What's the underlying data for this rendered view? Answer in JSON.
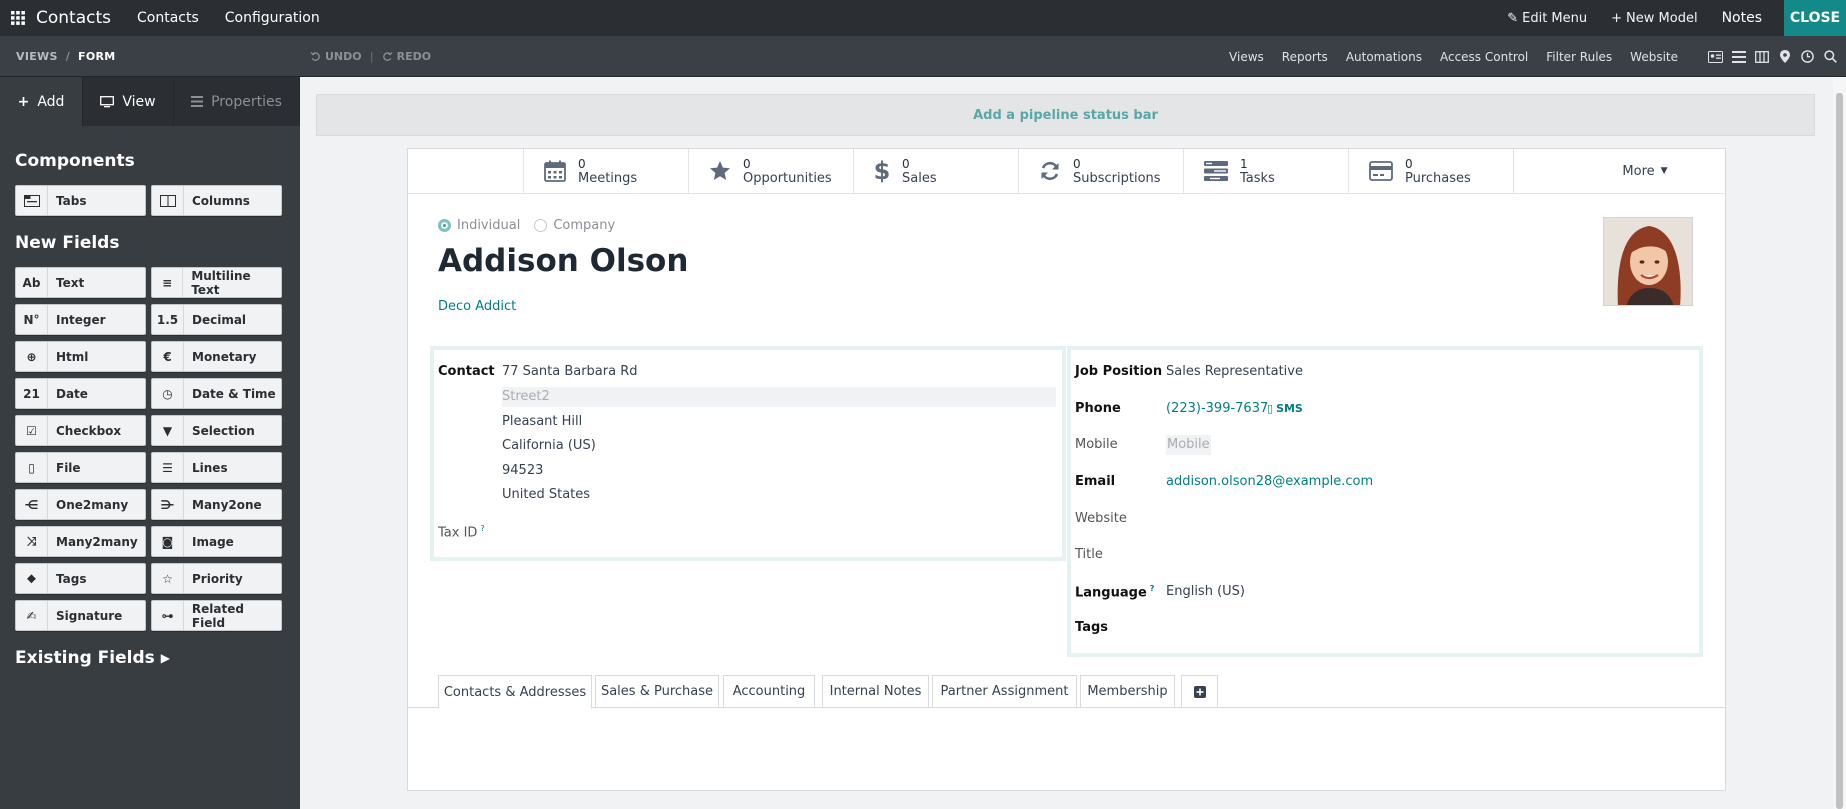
{
  "topbar": {
    "app_title": "Contacts",
    "menu": [
      "Contacts",
      "Configuration"
    ],
    "edit_menu": "Edit Menu",
    "new_model": "New Model",
    "notes": "Notes",
    "close": "CLOSE"
  },
  "secondary": {
    "breadcrumb": [
      "VIEWS",
      "FORM"
    ],
    "undo": "UNDO",
    "redo": "REDO",
    "links": [
      "Views",
      "Reports",
      "Automations",
      "Access Control",
      "Filter Rules",
      "Website"
    ],
    "view_icons": [
      "contact-card-icon",
      "list-icon",
      "kanban-icon",
      "map-pin-icon",
      "clock-icon",
      "search-icon"
    ]
  },
  "sidebar": {
    "tabs": [
      "Add",
      "View",
      "Properties"
    ],
    "components_title": "Components",
    "components": [
      {
        "label": "Tabs",
        "icon": "tabs-icon"
      },
      {
        "label": "Columns",
        "icon": "columns-icon"
      }
    ],
    "new_fields_title": "New Fields",
    "fields": [
      {
        "label": "Text",
        "icon": "text-icon",
        "glyph": "Ab"
      },
      {
        "label": "Multiline Text",
        "icon": "multiline-text-icon",
        "glyph": "≡"
      },
      {
        "label": "Integer",
        "icon": "integer-icon",
        "glyph": "N°"
      },
      {
        "label": "Decimal",
        "icon": "decimal-icon",
        "glyph": "1.5"
      },
      {
        "label": "Html",
        "icon": "html-globe-icon",
        "glyph": "⊕"
      },
      {
        "label": "Monetary",
        "icon": "monetary-icon",
        "glyph": "€"
      },
      {
        "label": "Date",
        "icon": "date-icon",
        "glyph": "21"
      },
      {
        "label": "Date & Time",
        "icon": "date-time-icon",
        "glyph": "◷"
      },
      {
        "label": "Checkbox",
        "icon": "checkbox-icon",
        "glyph": "☑"
      },
      {
        "label": "Selection",
        "icon": "selection-icon",
        "glyph": "▼"
      },
      {
        "label": "File",
        "icon": "file-icon",
        "glyph": "▯"
      },
      {
        "label": "Lines",
        "icon": "lines-icon",
        "glyph": "☰"
      },
      {
        "label": "One2many",
        "icon": "one2many-icon",
        "glyph": "⋲"
      },
      {
        "label": "Many2one",
        "icon": "many2one-icon",
        "glyph": "⋺"
      },
      {
        "label": "Many2many",
        "icon": "many2many-icon",
        "glyph": "⤨"
      },
      {
        "label": "Image",
        "icon": "image-camera-icon",
        "glyph": "◙"
      },
      {
        "label": "Tags",
        "icon": "tags-icon",
        "glyph": "⬥"
      },
      {
        "label": "Priority",
        "icon": "priority-star-icon",
        "glyph": "☆"
      },
      {
        "label": "Signature",
        "icon": "signature-icon",
        "glyph": "✍"
      },
      {
        "label": "Related Field",
        "icon": "related-link-icon",
        "glyph": "⊶"
      }
    ],
    "existing_fields": "Existing Fields"
  },
  "pipeline": "Add a pipeline status bar",
  "buttons": [
    {
      "count": "0",
      "label": "Meetings",
      "icon": "calendar-icon"
    },
    {
      "count": "0",
      "label": "Opportunities",
      "icon": "star-icon"
    },
    {
      "count": "0",
      "label": "Sales",
      "icon": "dollar-icon"
    },
    {
      "count": "0",
      "label": "Subscriptions",
      "icon": "refresh-icon"
    },
    {
      "count": "1",
      "label": "Tasks",
      "icon": "tasks-icon"
    },
    {
      "count": "0",
      "label": "Purchases",
      "icon": "credit-card-icon"
    }
  ],
  "more": "More",
  "form": {
    "type_individual": "Individual",
    "type_company": "Company",
    "name": "Addison Olson",
    "company": "Deco Addict",
    "left": {
      "contact_label": "Contact",
      "street": "77 Santa Barbara Rd",
      "street2_placeholder": "Street2",
      "city": "Pleasant Hill",
      "state": "California (US)",
      "zip": "94523",
      "country": "United States",
      "tax_label": "Tax ID",
      "tax_help": "?"
    },
    "right": {
      "job_label": "Job Position",
      "job": "Sales Representative",
      "phone_label": "Phone",
      "phone": "(223)-399-7637",
      "sms": "SMS",
      "mobile_label": "Mobile",
      "mobile_placeholder": "Mobile",
      "email_label": "Email",
      "email": "addison.olson28@example.com",
      "website_label": "Website",
      "title_label": "Title",
      "language_label": "Language",
      "language_help": "?",
      "language": "English (US)",
      "tags_label": "Tags"
    }
  },
  "tabs": [
    "Contacts & Addresses",
    "Sales & Purchase",
    "Accounting",
    "Internal Notes",
    "Partner Assignment",
    "Membership"
  ]
}
